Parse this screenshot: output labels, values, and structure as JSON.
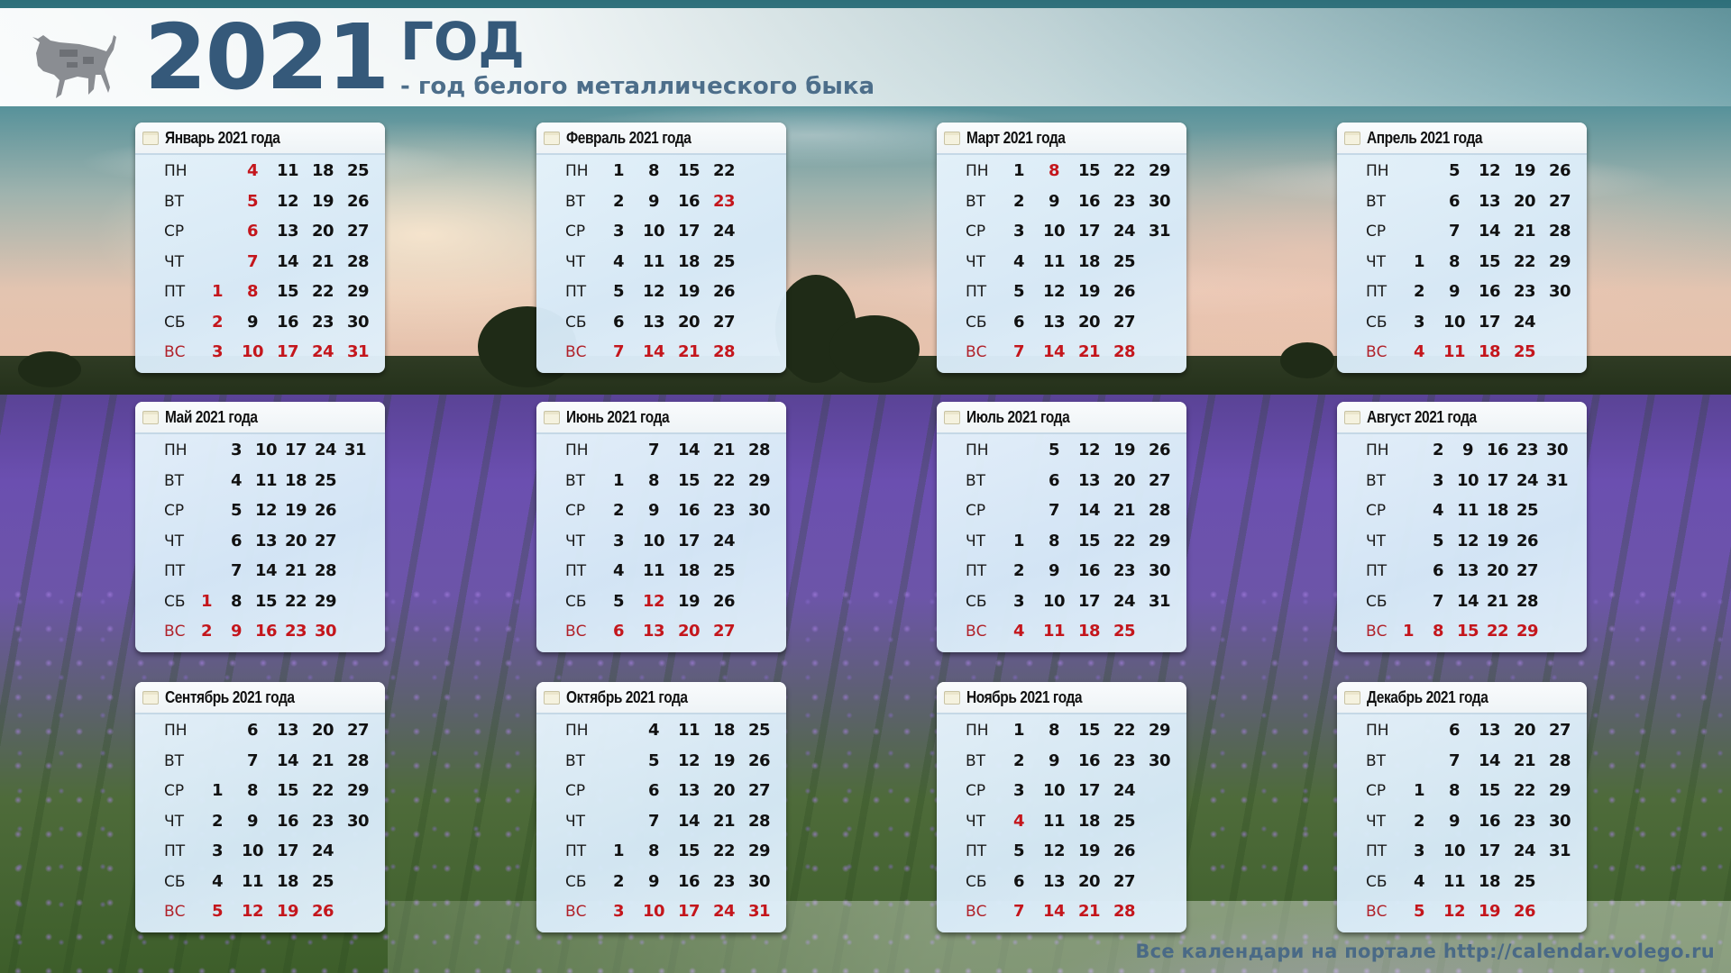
{
  "header": {
    "year": "2021",
    "god": "ГОД",
    "subtitle": "- год белого металлического быка",
    "icon": "bull-icon"
  },
  "footer": {
    "text": "Все календари на портале http://calendar.volego.ru"
  },
  "colors": {
    "title_blue": "#35597a",
    "holiday_red": "#c4161c",
    "card_bg": "#dbeaf6",
    "text_dark": "#111111"
  },
  "weekdays": [
    "ПН",
    "ВТ",
    "СР",
    "ЧТ",
    "ПТ",
    "СБ",
    "ВС"
  ],
  "months": [
    {
      "title": "Январь 2021 года",
      "weeks": [
        [
          null,
          null,
          null,
          null,
          1,
          2,
          3
        ],
        [
          4,
          5,
          6,
          7,
          8,
          9,
          10
        ],
        [
          11,
          12,
          13,
          14,
          15,
          16,
          17
        ],
        [
          18,
          19,
          20,
          21,
          22,
          23,
          24
        ],
        [
          25,
          26,
          27,
          28,
          29,
          30,
          31
        ]
      ],
      "red": [
        1,
        2,
        3,
        4,
        5,
        6,
        7,
        8,
        10,
        17,
        24,
        31
      ]
    },
    {
      "title": "Февраль 2021 года",
      "weeks": [
        [
          1,
          2,
          3,
          4,
          5,
          6,
          7
        ],
        [
          8,
          9,
          10,
          11,
          12,
          13,
          14
        ],
        [
          15,
          16,
          17,
          18,
          19,
          20,
          21
        ],
        [
          22,
          23,
          24,
          25,
          26,
          27,
          28
        ]
      ],
      "red": [
        7,
        14,
        21,
        23,
        28
      ]
    },
    {
      "title": "Март 2021 года",
      "weeks": [
        [
          1,
          2,
          3,
          4,
          5,
          6,
          7
        ],
        [
          8,
          9,
          10,
          11,
          12,
          13,
          14
        ],
        [
          15,
          16,
          17,
          18,
          19,
          20,
          21
        ],
        [
          22,
          23,
          24,
          25,
          26,
          27,
          28
        ],
        [
          29,
          30,
          31,
          null,
          null,
          null,
          null
        ]
      ],
      "red": [
        7,
        8,
        14,
        21,
        28
      ]
    },
    {
      "title": "Апрель 2021 года",
      "weeks": [
        [
          null,
          null,
          null,
          1,
          2,
          3,
          4
        ],
        [
          5,
          6,
          7,
          8,
          9,
          10,
          11
        ],
        [
          12,
          13,
          14,
          15,
          16,
          17,
          18
        ],
        [
          19,
          20,
          21,
          22,
          23,
          24,
          25
        ],
        [
          26,
          27,
          28,
          29,
          30,
          null,
          null
        ]
      ],
      "red": [
        4,
        11,
        18,
        25
      ]
    },
    {
      "title": "Май 2021 года",
      "weeks": [
        [
          null,
          null,
          null,
          null,
          null,
          1,
          2
        ],
        [
          3,
          4,
          5,
          6,
          7,
          8,
          9
        ],
        [
          10,
          11,
          12,
          13,
          14,
          15,
          16
        ],
        [
          17,
          18,
          19,
          20,
          21,
          22,
          23
        ],
        [
          24,
          25,
          26,
          27,
          28,
          29,
          30
        ],
        [
          31,
          null,
          null,
          null,
          null,
          null,
          null
        ]
      ],
      "red": [
        1,
        2,
        9,
        16,
        23,
        30
      ]
    },
    {
      "title": "Июнь 2021 года",
      "weeks": [
        [
          null,
          1,
          2,
          3,
          4,
          5,
          6
        ],
        [
          7,
          8,
          9,
          10,
          11,
          12,
          13
        ],
        [
          14,
          15,
          16,
          17,
          18,
          19,
          20
        ],
        [
          21,
          22,
          23,
          24,
          25,
          26,
          27
        ],
        [
          28,
          29,
          30,
          null,
          null,
          null,
          null
        ]
      ],
      "red": [
        6,
        12,
        13,
        20,
        27
      ]
    },
    {
      "title": "Июль 2021 года",
      "weeks": [
        [
          null,
          null,
          null,
          1,
          2,
          3,
          4
        ],
        [
          5,
          6,
          7,
          8,
          9,
          10,
          11
        ],
        [
          12,
          13,
          14,
          15,
          16,
          17,
          18
        ],
        [
          19,
          20,
          21,
          22,
          23,
          24,
          25
        ],
        [
          26,
          27,
          28,
          29,
          30,
          31,
          null
        ]
      ],
      "red": [
        4,
        11,
        18,
        25
      ]
    },
    {
      "title": "Август 2021 года",
      "weeks": [
        [
          null,
          null,
          null,
          null,
          null,
          null,
          1
        ],
        [
          2,
          3,
          4,
          5,
          6,
          7,
          8
        ],
        [
          9,
          10,
          11,
          12,
          13,
          14,
          15
        ],
        [
          16,
          17,
          18,
          19,
          20,
          21,
          22
        ],
        [
          23,
          24,
          25,
          26,
          27,
          28,
          29
        ],
        [
          30,
          31,
          null,
          null,
          null,
          null,
          null
        ]
      ],
      "red": [
        1,
        8,
        15,
        22,
        29
      ]
    },
    {
      "title": "Сентябрь 2021 года",
      "weeks": [
        [
          null,
          null,
          1,
          2,
          3,
          4,
          5
        ],
        [
          6,
          7,
          8,
          9,
          10,
          11,
          12
        ],
        [
          13,
          14,
          15,
          16,
          17,
          18,
          19
        ],
        [
          20,
          21,
          22,
          23,
          24,
          25,
          26
        ],
        [
          27,
          28,
          29,
          30,
          null,
          null,
          null
        ]
      ],
      "red": [
        5,
        12,
        19,
        26
      ]
    },
    {
      "title": "Октябрь 2021 года",
      "weeks": [
        [
          null,
          null,
          null,
          null,
          1,
          2,
          3
        ],
        [
          4,
          5,
          6,
          7,
          8,
          9,
          10
        ],
        [
          11,
          12,
          13,
          14,
          15,
          16,
          17
        ],
        [
          18,
          19,
          20,
          21,
          22,
          23,
          24
        ],
        [
          25,
          26,
          27,
          28,
          29,
          30,
          31
        ]
      ],
      "red": [
        3,
        10,
        17,
        24,
        31
      ]
    },
    {
      "title": "Ноябрь 2021 года",
      "weeks": [
        [
          1,
          2,
          3,
          4,
          5,
          6,
          7
        ],
        [
          8,
          9,
          10,
          11,
          12,
          13,
          14
        ],
        [
          15,
          16,
          17,
          18,
          19,
          20,
          21
        ],
        [
          22,
          23,
          24,
          25,
          26,
          27,
          28
        ],
        [
          29,
          30,
          null,
          null,
          null,
          null,
          null
        ]
      ],
      "red": [
        4,
        7,
        14,
        21,
        28
      ]
    },
    {
      "title": "Декабрь 2021 года",
      "weeks": [
        [
          null,
          null,
          1,
          2,
          3,
          4,
          5
        ],
        [
          6,
          7,
          8,
          9,
          10,
          11,
          12
        ],
        [
          13,
          14,
          15,
          16,
          17,
          18,
          19
        ],
        [
          20,
          21,
          22,
          23,
          24,
          25,
          26
        ],
        [
          27,
          28,
          29,
          30,
          31,
          null,
          null
        ]
      ],
      "red": [
        5,
        12,
        19,
        26
      ]
    }
  ]
}
